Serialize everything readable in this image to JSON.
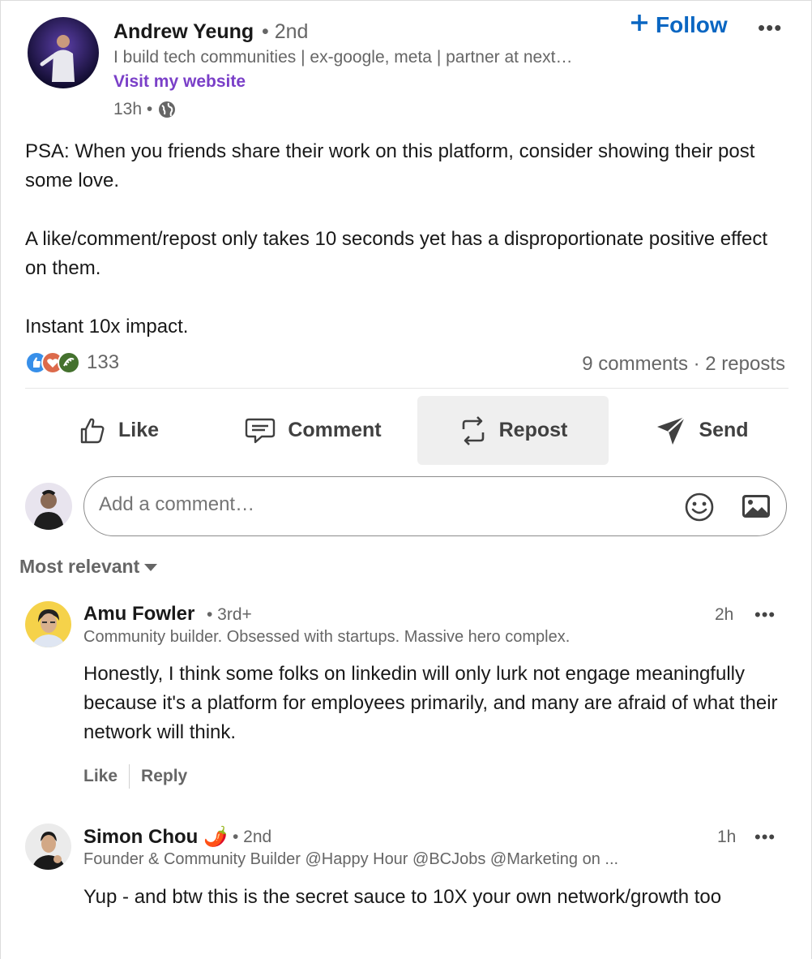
{
  "author": {
    "name": "Andrew Yeung",
    "degree": "• 2nd",
    "headline": "I build tech communities | ex-google, meta | partner at next…",
    "website_link": "Visit my website",
    "time": "13h •",
    "follow_label": "Follow",
    "more_label": "•••"
  },
  "post": {
    "paragraphs": [
      "PSA: When you friends share their work on this platform, consider showing their post some love.",
      "A like/comment/repost only takes 10 seconds yet has a disproportionate positive effect on them.",
      "Instant 10x impact."
    ]
  },
  "social": {
    "reaction_count": "133",
    "comments_reposts": "9 comments · 2 reposts",
    "reaction_colors": [
      "#378fe9",
      "#dc6a4b",
      "#44712e"
    ]
  },
  "actions": {
    "like": "Like",
    "comment": "Comment",
    "repost": "Repost",
    "send": "Send"
  },
  "comment_box": {
    "placeholder": "Add a comment…"
  },
  "sort": {
    "label": "Most relevant"
  },
  "comments": [
    {
      "name": "Amu Fowler",
      "degree": "• 3rd+",
      "headline": "Community builder. Obsessed with startups. Massive hero complex.",
      "time": "2h",
      "more": "•••",
      "text": "Honestly, I think some folks on linkedin will only lurk not engage meaningfully because it's a platform for employees primarily, and many are afraid of what their network will think.",
      "like": "Like",
      "reply": "Reply"
    },
    {
      "name": "Simon Chou 🌶️",
      "degree": "• 2nd",
      "headline": "Founder & Community Builder @Happy Hour @BCJobs @Marketing on ...",
      "time": "1h",
      "more": "•••",
      "text": "Yup - and btw this is the secret sauce to 10X your own network/growth too"
    }
  ]
}
